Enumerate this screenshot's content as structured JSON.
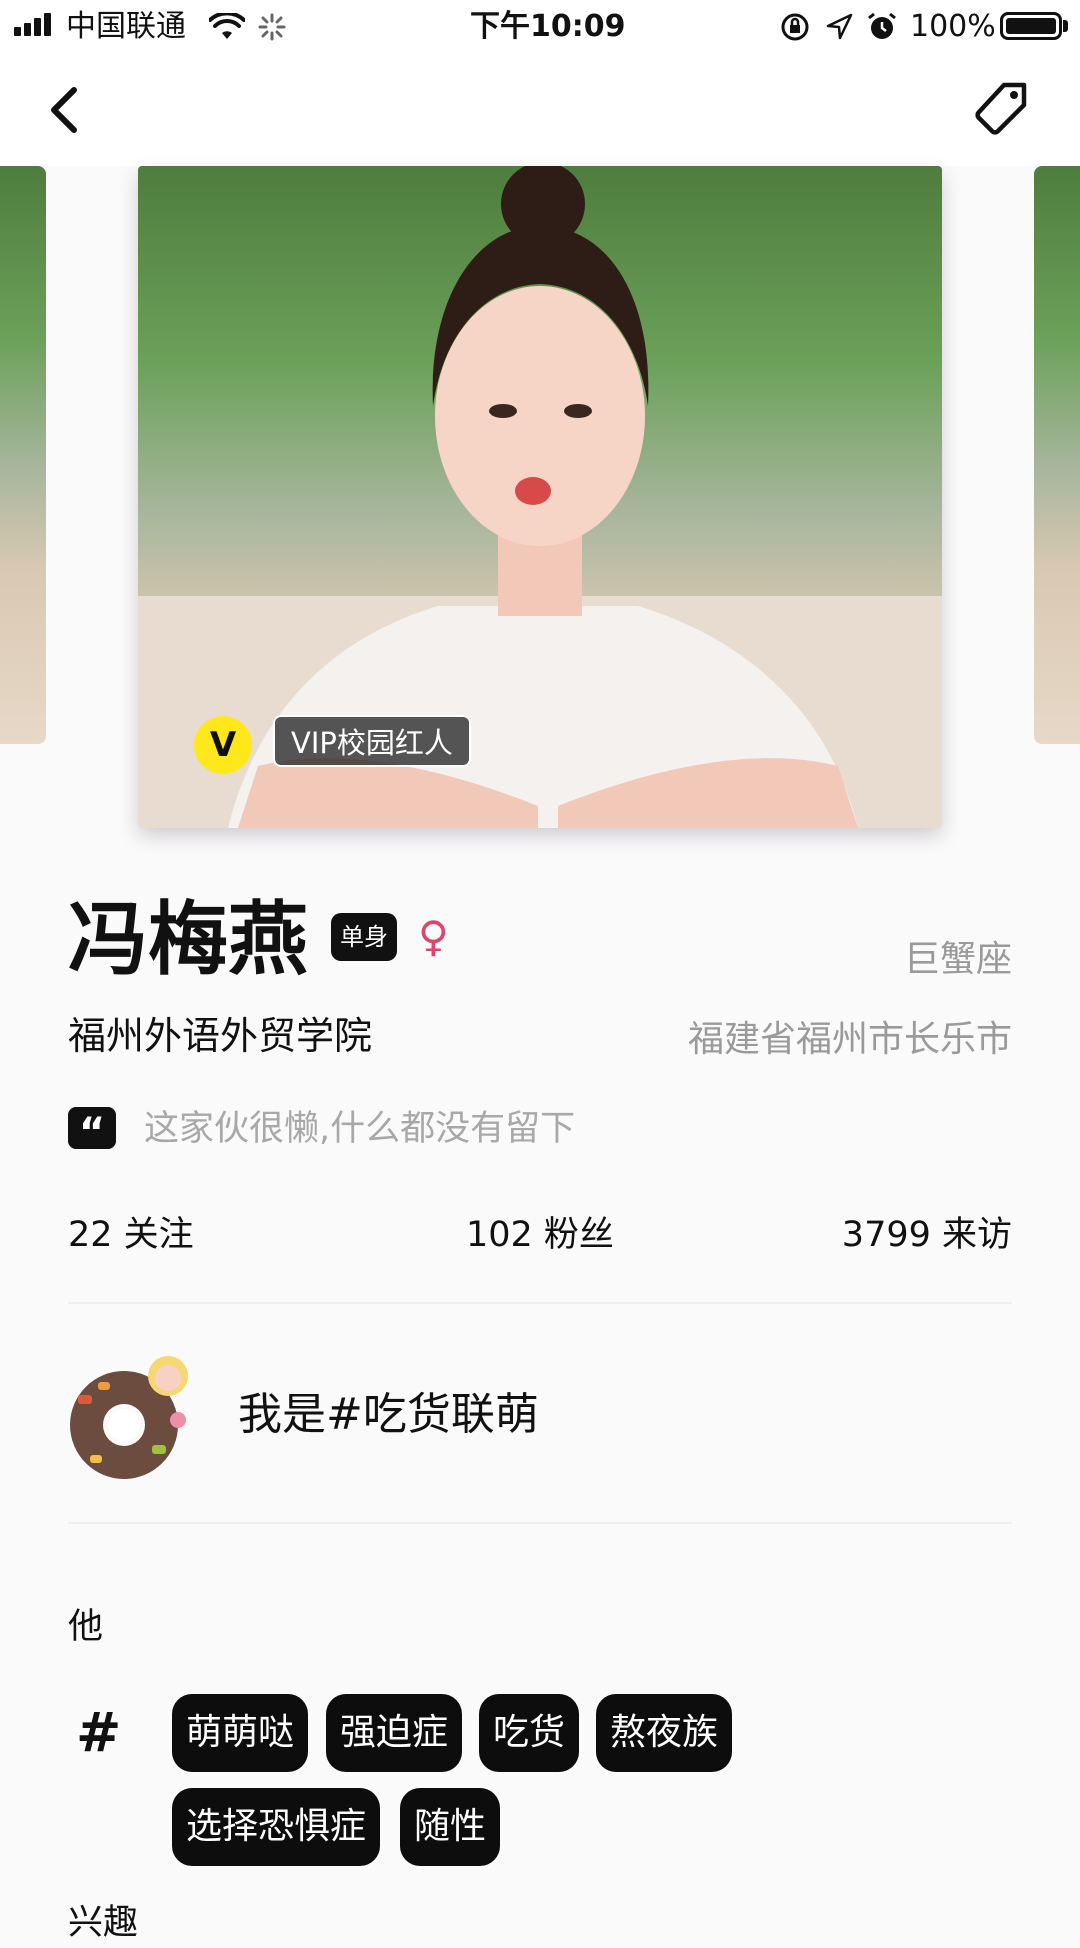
{
  "status_bar": {
    "carrier": "中国联通",
    "time": "下午10:09",
    "battery": "100%"
  },
  "nav": {
    "back_icon": "back-arrow-icon",
    "tag_icon": "tag-icon"
  },
  "photo": {
    "vip_letter": "V",
    "vip_label": "VIP校园红人"
  },
  "profile": {
    "name": "冯梅燕",
    "relationship_status": "单身",
    "gender_symbol": "♀",
    "zodiac": "巨蟹座",
    "school": "福州外语外贸学院",
    "location": "福建省福州市长乐市",
    "quote_mark": "“",
    "bio": "这家伙很懒,什么都没有留下"
  },
  "stats": {
    "following": "22 关注",
    "followers": "102 粉丝",
    "visitors": "3799 来访"
  },
  "badge": {
    "text": "我是#吃货联萌"
  },
  "tags_section": {
    "label": "他",
    "hash": "#",
    "tags": [
      "萌萌哒",
      "强迫症",
      "吃货",
      "熬夜族",
      "选择恐惧症",
      "随性"
    ]
  },
  "next_section": {
    "label": "兴趣"
  }
}
